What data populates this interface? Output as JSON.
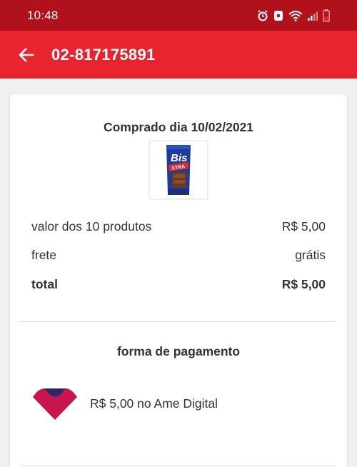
{
  "status_bar": {
    "time": "10:48",
    "icons": [
      "alarm-icon",
      "notification-icon",
      "wifi-icon",
      "signal-icon",
      "battery-icon"
    ]
  },
  "app_bar": {
    "back_icon": "arrow-left-icon",
    "title": "02-817175891"
  },
  "order": {
    "purchased_label": "Comprado dia 10/02/2021",
    "product_image": "bis-xtra-chocolate",
    "summary": [
      {
        "label": "valor dos 10 produtos",
        "value": "R$ 5,00"
      },
      {
        "label": "frete",
        "value": "grátis"
      },
      {
        "label": "total",
        "value": "R$ 5,00"
      }
    ]
  },
  "payment": {
    "title": "forma de pagamento",
    "method_icon": "ame-digital-logo",
    "method_text": "R$ 5,00 no Ame Digital"
  },
  "colors": {
    "status_bar": "#b0111b",
    "app_bar": "#e8242f",
    "background": "#f0f0f0",
    "card": "#ffffff",
    "text": "#333333"
  }
}
